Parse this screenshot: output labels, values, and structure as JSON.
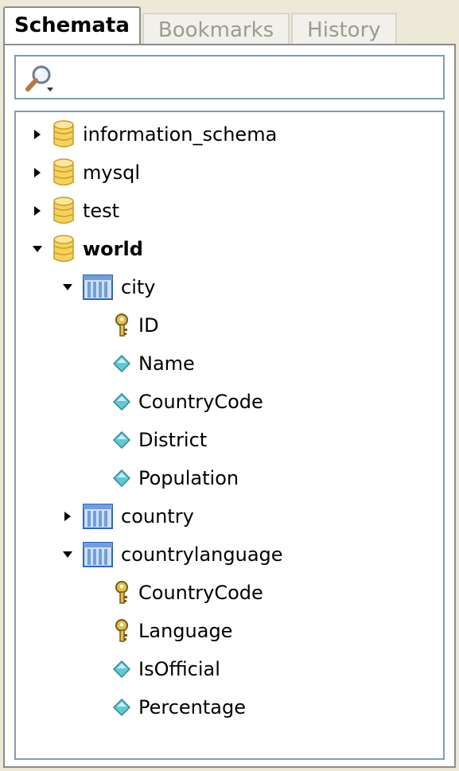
{
  "tabs": [
    {
      "label": "Schemata",
      "active": true
    },
    {
      "label": "Bookmarks",
      "active": false
    },
    {
      "label": "History",
      "active": false
    }
  ],
  "search": {
    "value": "",
    "icon": "magnifier-dropdown-icon"
  },
  "tree": {
    "schemas": [
      {
        "name": "information_schema",
        "expanded": false,
        "icon": "database-icon"
      },
      {
        "name": "mysql",
        "expanded": false,
        "icon": "database-icon"
      },
      {
        "name": "test",
        "expanded": false,
        "icon": "database-icon"
      },
      {
        "name": "world",
        "expanded": true,
        "bold": true,
        "icon": "database-icon",
        "tables": [
          {
            "name": "city",
            "expanded": true,
            "icon": "table-icon",
            "columns": [
              {
                "name": "ID",
                "icon": "primary-key-icon"
              },
              {
                "name": "Name",
                "icon": "column-icon"
              },
              {
                "name": "CountryCode",
                "icon": "column-icon"
              },
              {
                "name": "District",
                "icon": "column-icon"
              },
              {
                "name": "Population",
                "icon": "column-icon"
              }
            ]
          },
          {
            "name": "country",
            "expanded": false,
            "icon": "table-icon",
            "columns": []
          },
          {
            "name": "countrylanguage",
            "expanded": true,
            "icon": "table-icon",
            "columns": [
              {
                "name": "CountryCode",
                "icon": "primary-key-icon"
              },
              {
                "name": "Language",
                "icon": "primary-key-icon"
              },
              {
                "name": "IsOfficial",
                "icon": "column-icon"
              },
              {
                "name": "Percentage",
                "icon": "column-icon"
              }
            ]
          }
        ]
      }
    ]
  },
  "colors": {
    "database": "#f5d35a",
    "table": "#6f9fe0",
    "column": "#5fc9d6",
    "key": "#e0c24a"
  }
}
